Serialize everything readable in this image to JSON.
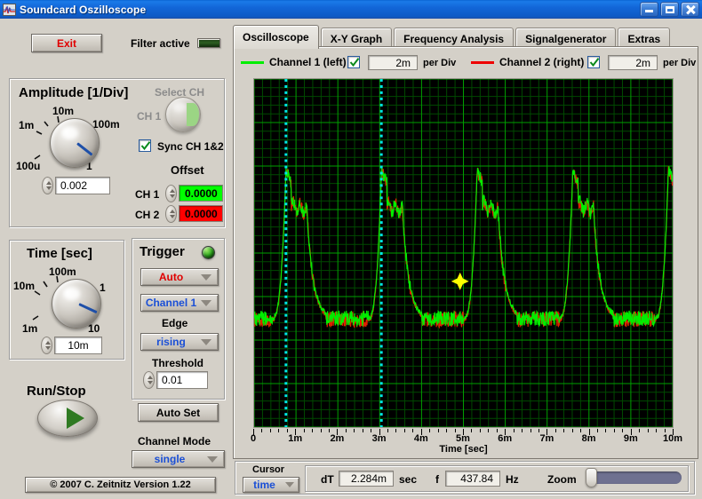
{
  "window": {
    "title": "Soundcard Oszilloscope",
    "icon": "oscilloscope-icon",
    "minimize_label": "",
    "maximize_label": "",
    "close_label": ""
  },
  "toolbar": {
    "exit_label": "Exit",
    "filter_label": "Filter active",
    "filter_state": "off"
  },
  "amplitude": {
    "title": "Amplitude [1/Div]",
    "knob_ticks": [
      "100u",
      "1m",
      "10m",
      "100m",
      "1"
    ],
    "value": "0.002",
    "select_ch_label": "Select CH",
    "select_ch_value": "CH 1",
    "sync_label": "Sync CH 1&2",
    "sync_checked": true,
    "offset_title": "Offset",
    "ch1_label": "CH 1",
    "ch1_offset": "0.0000",
    "ch2_label": "CH 2",
    "ch2_offset": "0.0000",
    "ch1_color": "#00ff00",
    "ch2_color": "#ff0000"
  },
  "time": {
    "title": "Time [sec]",
    "knob_ticks": [
      "1m",
      "10m",
      "100m",
      "1",
      "10"
    ],
    "value": "10m"
  },
  "trigger": {
    "title": "Trigger",
    "led_state": "on",
    "mode": "Auto",
    "source": "Channel 1",
    "edge_label": "Edge",
    "edge": "rising",
    "threshold_label": "Threshold",
    "threshold": "0.01",
    "autoset_label": "Auto Set"
  },
  "runstop": {
    "label": "Run/Stop"
  },
  "channel_mode": {
    "label": "Channel Mode",
    "value": "single"
  },
  "copyright": "© 2007   C. Zeitnitz Version 1.22",
  "tabs": [
    {
      "label": "Oscilloscope",
      "active": true
    },
    {
      "label": "X-Y Graph",
      "active": false
    },
    {
      "label": "Frequency Analysis",
      "active": false
    },
    {
      "label": "Signalgenerator",
      "active": false
    },
    {
      "label": "Extras",
      "active": false
    }
  ],
  "channels": [
    {
      "name": "Channel 1 (left)",
      "color": "#00ee00",
      "enabled": true,
      "per_div": "2m",
      "per_div_unit": "per Div"
    },
    {
      "name": "Channel 2 (right)",
      "color": "#ee0000",
      "enabled": true,
      "per_div": "2m",
      "per_div_unit": "per Div"
    }
  ],
  "status": {
    "cursor_label": "Cursor",
    "cursor_mode": "time",
    "dt_label": "dT",
    "dt_value": "2.284m",
    "dt_unit": "sec",
    "f_label": "f",
    "f_value": "437.84",
    "f_unit": "Hz",
    "zoom_label": "Zoom",
    "zoom_value": 0
  },
  "chart_data": {
    "type": "line",
    "title": "",
    "xlabel": "Time [sec]",
    "ylabel": "",
    "xlim": [
      0,
      0.01
    ],
    "xtick_labels": [
      "0",
      "1m",
      "2m",
      "3m",
      "4m",
      "5m",
      "6m",
      "7m",
      "8m",
      "9m",
      "10m"
    ],
    "xtick_values": [
      0,
      0.001,
      0.002,
      0.003,
      0.004,
      0.005,
      0.006,
      0.007,
      0.008,
      0.009,
      0.01
    ],
    "ylim": [
      -0.008,
      0.008
    ],
    "grid": true,
    "grid_major_color": "#00a000",
    "grid_minor_color": "#004a00",
    "background": "#000000",
    "divisions_x": 10,
    "divisions_y": 8,
    "legend_position": "top",
    "cursors": [
      {
        "name": "cursor-1",
        "x": 0.00076,
        "color": "#00e5e5",
        "style": "dotted"
      },
      {
        "name": "cursor-2",
        "x": 0.00304,
        "color": "#00e5e5",
        "style": "dotted"
      }
    ],
    "cursor_marker": {
      "x": 0.00492,
      "y": -0.0013,
      "color": "#ffff00"
    },
    "waveform": {
      "shape": "sawtooth-burst",
      "period": 0.002284,
      "frequency_hz": 437.84,
      "peaks_x": [
        0.00076,
        0.00304,
        0.00532,
        0.0076,
        0.00988
      ],
      "baseline_y": -0.003,
      "peak_y": 0.0038,
      "plateau_y": 0.0022,
      "noise_amplitude": 0.00035
    },
    "series": [
      {
        "name": "Channel 1 (left)",
        "color": "#00ee00"
      },
      {
        "name": "Channel 2 (right)",
        "color": "#dd2200"
      }
    ]
  }
}
